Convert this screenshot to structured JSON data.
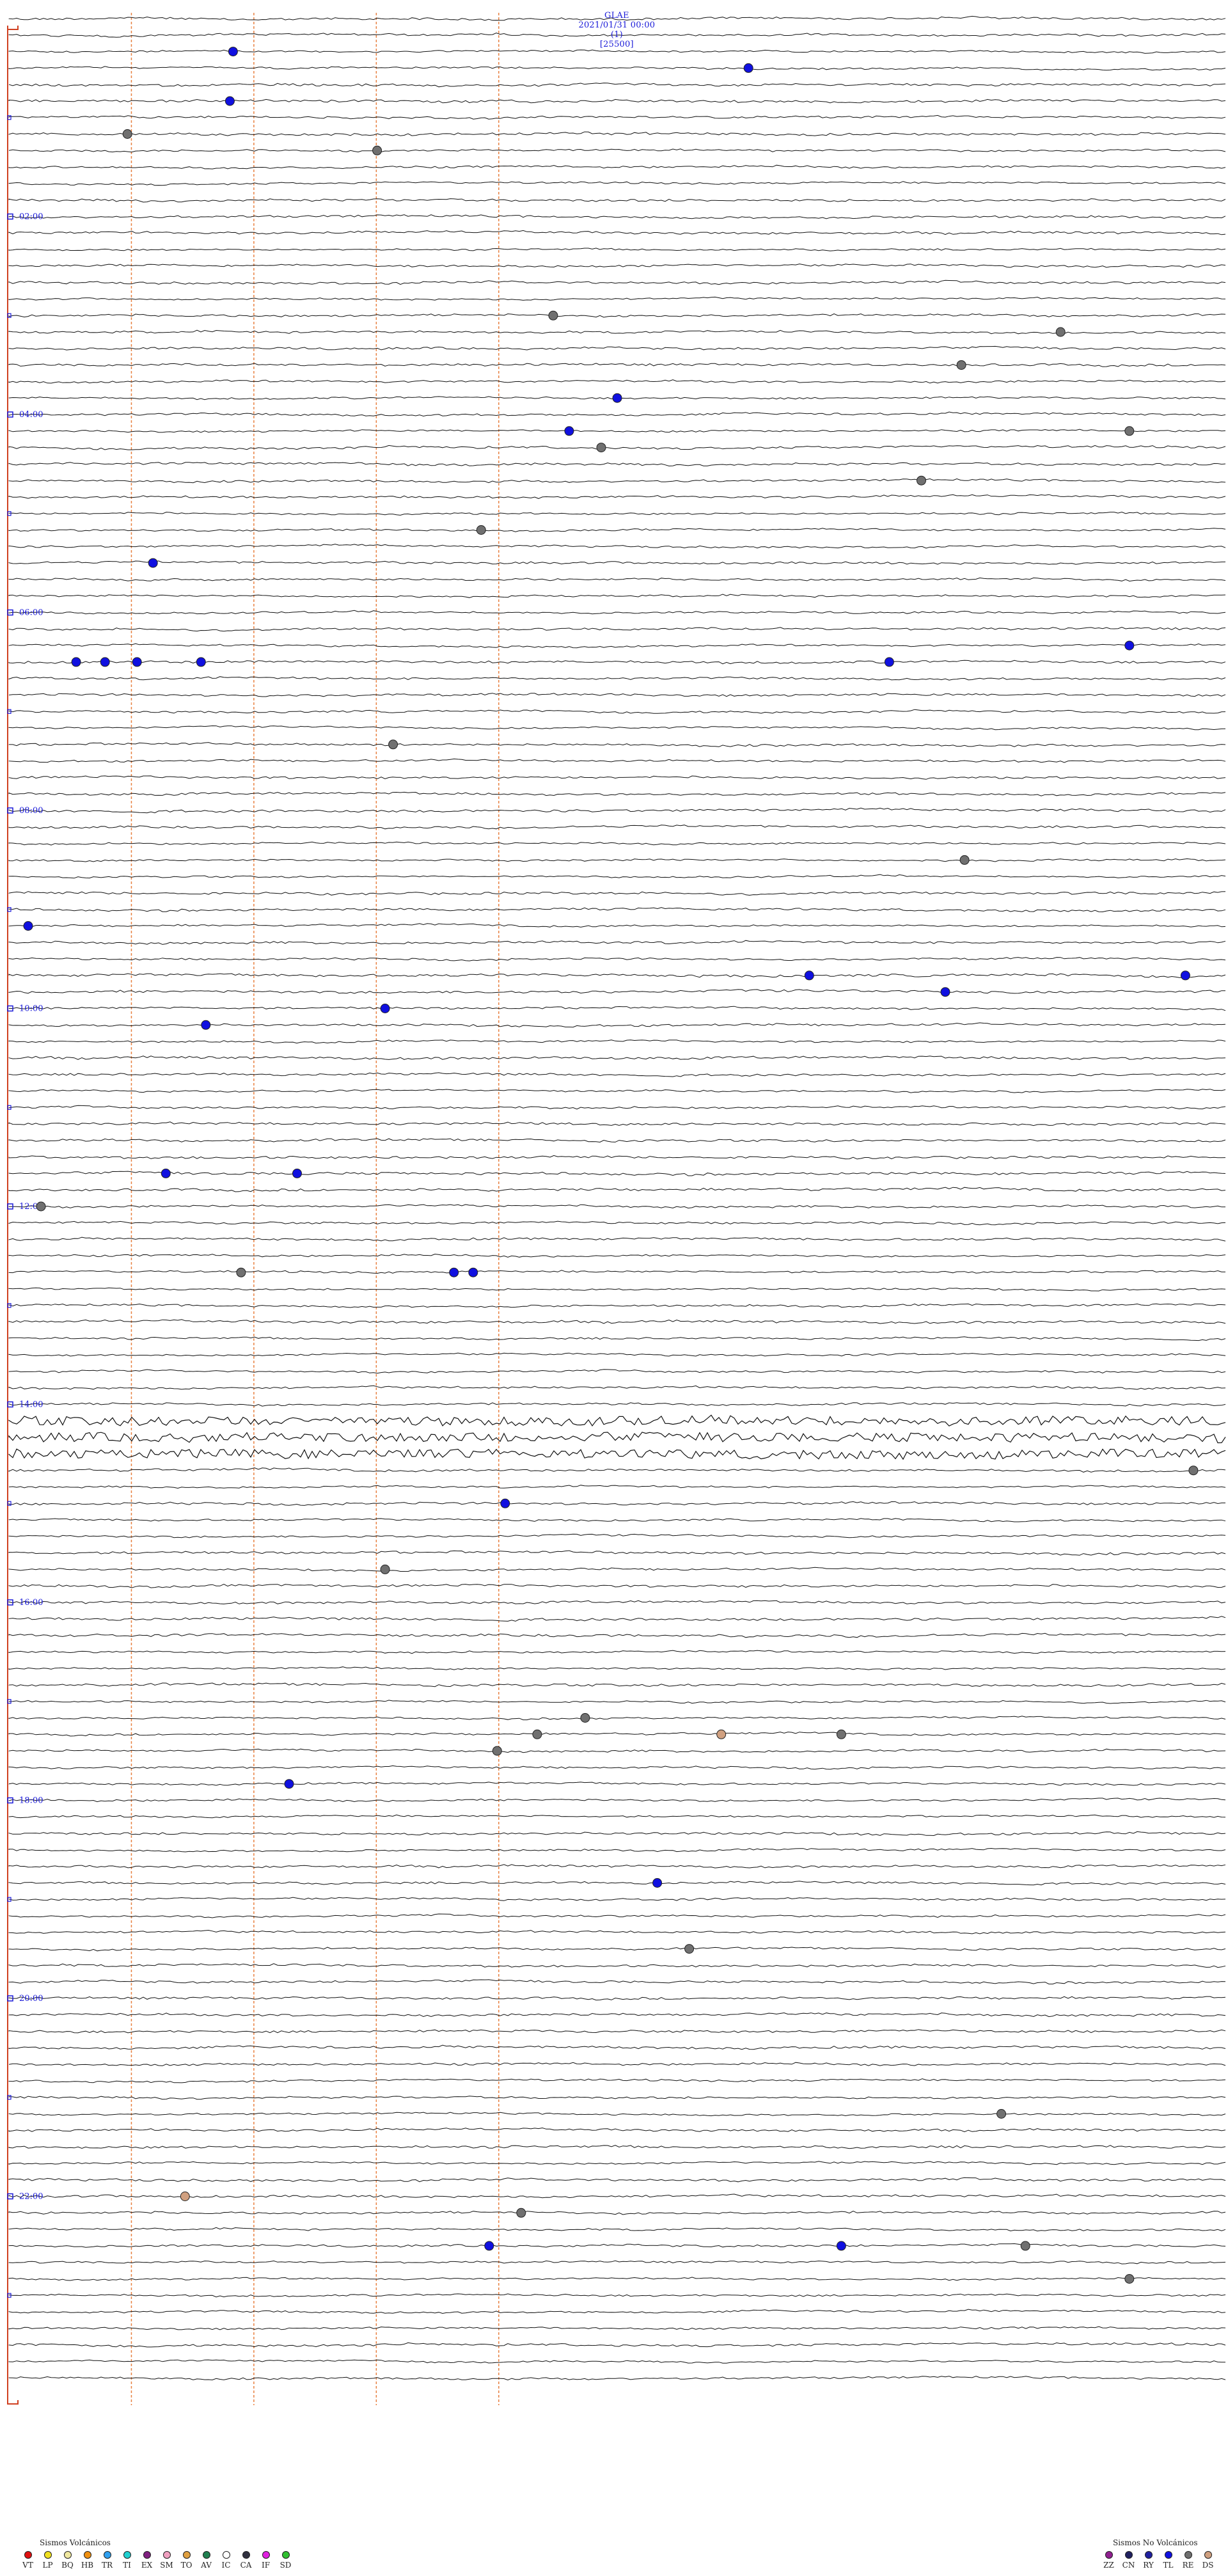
{
  "header": {
    "station": "GLAE",
    "datetime": "2021/01/31 00:00",
    "channel": "(1)",
    "scale": "[25500]"
  },
  "chart_data": {
    "type": "helicorder",
    "hour_labels": [
      "02:00",
      "04:00",
      "06:00",
      "08:00",
      "10:00",
      "12:00",
      "14:00",
      "16:00",
      "18:00",
      "20:00",
      "22:00"
    ],
    "trace_count": 144,
    "minute_markers": [
      15,
      30,
      45,
      60
    ],
    "events": [
      {
        "trace": 2,
        "minute": 14.0,
        "type": "TL"
      },
      {
        "trace": 3,
        "minute": 46.2,
        "type": "TL"
      },
      {
        "trace": 5,
        "minute": 13.8,
        "type": "TL"
      },
      {
        "trace": 7,
        "minute": 7.4,
        "type": "RE"
      },
      {
        "trace": 8,
        "minute": 23.0,
        "type": "RE"
      },
      {
        "trace": 18,
        "minute": 34.0,
        "type": "RE"
      },
      {
        "trace": 19,
        "minute": 65.7,
        "type": "RE"
      },
      {
        "trace": 21,
        "minute": 59.5,
        "type": "RE"
      },
      {
        "trace": 23,
        "minute": 38.0,
        "type": "TL"
      },
      {
        "trace": 25,
        "minute": 35.0,
        "type": "TL"
      },
      {
        "trace": 25,
        "minute": 70.0,
        "type": "RE"
      },
      {
        "trace": 26,
        "minute": 37.0,
        "type": "RE"
      },
      {
        "trace": 28,
        "minute": 57.0,
        "type": "RE"
      },
      {
        "trace": 31,
        "minute": 29.5,
        "type": "RE"
      },
      {
        "trace": 33,
        "minute": 9.0,
        "type": "TL"
      },
      {
        "trace": 39,
        "minute": 4.2,
        "type": "TL"
      },
      {
        "trace": 39,
        "minute": 6.0,
        "type": "TL"
      },
      {
        "trace": 39,
        "minute": 8.0,
        "type": "TL"
      },
      {
        "trace": 39,
        "minute": 12.0,
        "type": "TL"
      },
      {
        "trace": 39,
        "minute": 55.0,
        "type": "TL"
      },
      {
        "trace": 38,
        "minute": 70.0,
        "type": "TL"
      },
      {
        "trace": 44,
        "minute": 24.0,
        "type": "RE"
      },
      {
        "trace": 51,
        "minute": 59.7,
        "type": "RE"
      },
      {
        "trace": 55,
        "minute": 1.2,
        "type": "TL"
      },
      {
        "trace": 58,
        "minute": 50.0,
        "type": "TL"
      },
      {
        "trace": 58,
        "minute": 73.5,
        "type": "TL"
      },
      {
        "trace": 59,
        "minute": 58.5,
        "type": "TL"
      },
      {
        "trace": 61,
        "minute": 12.3,
        "type": "TL"
      },
      {
        "trace": 60,
        "minute": 23.5,
        "type": "TL"
      },
      {
        "trace": 70,
        "minute": 9.8,
        "type": "TL"
      },
      {
        "trace": 70,
        "minute": 18.0,
        "type": "TL"
      },
      {
        "trace": 72,
        "minute": 2.0,
        "type": "RE"
      },
      {
        "trace": 76,
        "minute": 14.5,
        "type": "RE"
      },
      {
        "trace": 76,
        "minute": 27.8,
        "type": "TL"
      },
      {
        "trace": 76,
        "minute": 29.0,
        "type": "TL"
      },
      {
        "trace": 88,
        "minute": 74.0,
        "type": "RE"
      },
      {
        "trace": 90,
        "minute": 31.0,
        "type": "TL"
      },
      {
        "trace": 94,
        "minute": 23.5,
        "type": "RE"
      },
      {
        "trace": 103,
        "minute": 36.0,
        "type": "RE"
      },
      {
        "trace": 104,
        "minute": 33.0,
        "type": "RE"
      },
      {
        "trace": 104,
        "minute": 44.5,
        "type": "DS"
      },
      {
        "trace": 104,
        "minute": 52.0,
        "type": "RE"
      },
      {
        "trace": 105,
        "minute": 30.5,
        "type": "RE"
      },
      {
        "trace": 107,
        "minute": 17.5,
        "type": "TL"
      },
      {
        "trace": 113,
        "minute": 40.5,
        "type": "TL"
      },
      {
        "trace": 117,
        "minute": 42.5,
        "type": "RE"
      },
      {
        "trace": 127,
        "minute": 62.0,
        "type": "RE"
      },
      {
        "trace": 132,
        "minute": 11.0,
        "type": "DS"
      },
      {
        "trace": 133,
        "minute": 32.0,
        "type": "RE"
      },
      {
        "trace": 135,
        "minute": 30.0,
        "type": "TL"
      },
      {
        "trace": 135,
        "minute": 52.0,
        "type": "TL"
      },
      {
        "trace": 135,
        "minute": 63.5,
        "type": "RE"
      },
      {
        "trace": 137,
        "minute": 70.0,
        "type": "RE"
      }
    ]
  },
  "legend_volcanic": {
    "title": "Sismos Volcánicos",
    "items": [
      {
        "label": "VT",
        "color": "#e01010"
      },
      {
        "label": "LP",
        "color": "#f0e020"
      },
      {
        "label": "BQ",
        "color": "#f0e8a0"
      },
      {
        "label": "HB",
        "color": "#f09010"
      },
      {
        "label": "TR",
        "color": "#30a0f0"
      },
      {
        "label": "TI",
        "color": "#20d0d0"
      },
      {
        "label": "EX",
        "color": "#802080"
      },
      {
        "label": "SM",
        "color": "#f0a0c0"
      },
      {
        "label": "TO",
        "color": "#e0a040"
      },
      {
        "label": "AV",
        "color": "#208050"
      },
      {
        "label": "IC",
        "color": "#ffffff"
      },
      {
        "label": "CA",
        "color": "#303040"
      },
      {
        "label": "IF",
        "color": "#e020e0"
      },
      {
        "label": "SD",
        "color": "#30c030"
      }
    ]
  },
  "legend_non_volcanic": {
    "title": "Sismos No Volcánicos",
    "items": [
      {
        "label": "ZZ",
        "color": "#902090"
      },
      {
        "label": "CN",
        "color": "#202060"
      },
      {
        "label": "RY",
        "color": "#2020a0"
      },
      {
        "label": "TL",
        "color": "#1010e0"
      },
      {
        "label": "RE",
        "color": "#707070"
      },
      {
        "label": "DS",
        "color": "#d0a080"
      }
    ]
  }
}
